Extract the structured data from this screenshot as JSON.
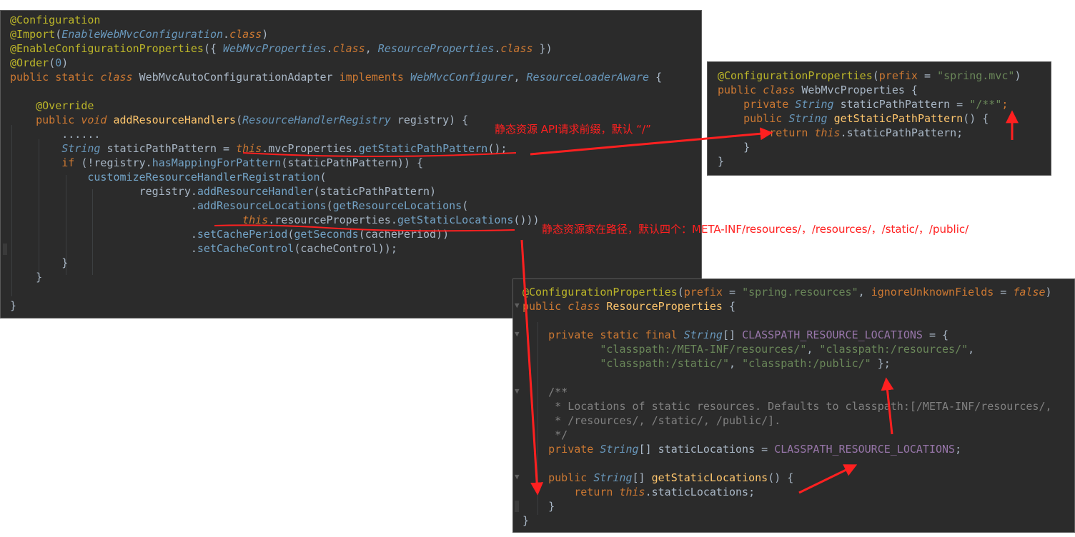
{
  "main_panel": {
    "lines": [
      [
        [
          "ann",
          "@Configuration"
        ]
      ],
      [
        [
          "ann",
          "@Import"
        ],
        [
          "pl",
          "("
        ],
        [
          "ty",
          "EnableWebMvcConfiguration"
        ],
        [
          "pl",
          "."
        ],
        [
          "kw it",
          "class"
        ],
        [
          "pl",
          ")"
        ]
      ],
      [
        [
          "ann",
          "@EnableConfigurationProperties"
        ],
        [
          "pl",
          "({ "
        ],
        [
          "ty",
          "WebMvcProperties"
        ],
        [
          "pl",
          "."
        ],
        [
          "kw it",
          "class"
        ],
        [
          "pl",
          ", "
        ],
        [
          "ty",
          "ResourceProperties"
        ],
        [
          "pl",
          "."
        ],
        [
          "kw it",
          "class"
        ],
        [
          "pl",
          " })"
        ]
      ],
      [
        [
          "ann",
          "@Order"
        ],
        [
          "pl",
          "("
        ],
        [
          "num",
          "0"
        ],
        [
          "pl",
          ")"
        ]
      ],
      [
        [
          "kw",
          "public static "
        ],
        [
          "kw it",
          "class "
        ],
        [
          "pl",
          "WebMvcAutoConfigurationAdapter "
        ],
        [
          "kw",
          "implements "
        ],
        [
          "ty",
          "WebMvcConfigurer"
        ],
        [
          "pl",
          ", "
        ],
        [
          "ty",
          "ResourceLoaderAware"
        ],
        [
          "pl",
          " {"
        ]
      ],
      [],
      [
        [
          "pl",
          "    "
        ],
        [
          "ann",
          "@Override"
        ]
      ],
      [
        [
          "pl",
          "    "
        ],
        [
          "kw",
          "public "
        ],
        [
          "kw it",
          "void "
        ],
        [
          "fn",
          "addResourceHandlers"
        ],
        [
          "pl",
          "("
        ],
        [
          "ty",
          "ResourceHandlerRegistry "
        ],
        [
          "pl",
          "registry) {"
        ]
      ],
      [
        [
          "pl",
          "        ......"
        ]
      ],
      [
        [
          "pl",
          "        "
        ],
        [
          "ty",
          "String "
        ],
        [
          "pl",
          "staticPathPattern = "
        ],
        [
          "kw it",
          "this"
        ],
        [
          "pl",
          ".mvcProperties."
        ],
        [
          "mth",
          "getStaticPathPattern"
        ],
        [
          "pl",
          "();"
        ]
      ],
      [
        [
          "pl",
          "        "
        ],
        [
          "kw",
          "if "
        ],
        [
          "pl",
          "(!registry."
        ],
        [
          "mth",
          "hasMappingForPattern"
        ],
        [
          "pl",
          "(staticPathPattern)) {"
        ]
      ],
      [
        [
          "pl",
          "            "
        ],
        [
          "mth",
          "customizeResourceHandlerRegistration"
        ],
        [
          "pl",
          "("
        ]
      ],
      [
        [
          "pl",
          "                    registry."
        ],
        [
          "mth",
          "addResourceHandler"
        ],
        [
          "pl",
          "(staticPathPattern)"
        ]
      ],
      [
        [
          "pl",
          "                            ."
        ],
        [
          "mth",
          "addResourceLocations"
        ],
        [
          "pl",
          "("
        ],
        [
          "mth",
          "getResourceLocations"
        ],
        [
          "pl",
          "("
        ]
      ],
      [
        [
          "pl",
          "                                    "
        ],
        [
          "kw it",
          "this"
        ],
        [
          "pl",
          ".resourceProperties."
        ],
        [
          "mth",
          "getStaticLocations"
        ],
        [
          "pl",
          "()))"
        ]
      ],
      [
        [
          "pl",
          "                            ."
        ],
        [
          "mth",
          "setCachePeriod"
        ],
        [
          "pl",
          "("
        ],
        [
          "mth",
          "getSeconds"
        ],
        [
          "pl",
          "(cachePeriod))"
        ]
      ],
      [
        [
          "pl",
          "                            ."
        ],
        [
          "mth",
          "setCacheControl"
        ],
        [
          "pl",
          "(cacheControl));"
        ]
      ],
      [
        [
          "pl",
          "        }"
        ]
      ],
      [
        [
          "pl",
          "    }"
        ]
      ],
      [],
      [
        [
          "pl",
          "}"
        ]
      ]
    ]
  },
  "webmvc_panel": {
    "lines": [
      [
        [
          "ann",
          "@ConfigurationProperties"
        ],
        [
          "pl",
          "("
        ],
        [
          "prm",
          "prefix"
        ],
        [
          "pl",
          " = "
        ],
        [
          "str",
          "\"spring.mvc\""
        ],
        [
          "pl",
          ")"
        ]
      ],
      [
        [
          "kw",
          "public "
        ],
        [
          "kw it",
          "class "
        ],
        [
          "pl",
          "WebMvcProperties {"
        ]
      ],
      [
        [
          "pl",
          "    "
        ],
        [
          "kw",
          "private "
        ],
        [
          "ty",
          "String "
        ],
        [
          "pl",
          "staticPathPattern = "
        ],
        [
          "str",
          "\"/**\""
        ],
        [
          "kw",
          ";"
        ]
      ],
      [
        [
          "pl",
          "    "
        ],
        [
          "kw",
          "public "
        ],
        [
          "ty",
          "String "
        ],
        [
          "fn",
          "getStaticPathPattern"
        ],
        [
          "pl",
          "() {"
        ]
      ],
      [
        [
          "pl",
          "        "
        ],
        [
          "kw",
          "return "
        ],
        [
          "kw it",
          "this"
        ],
        [
          "pl",
          ".staticPathPattern;"
        ]
      ],
      [
        [
          "pl",
          "    }"
        ]
      ],
      [
        [
          "pl",
          "}"
        ]
      ]
    ]
  },
  "resource_panel": {
    "lines": [
      [
        [
          "ann",
          "@ConfigurationProperties"
        ],
        [
          "pl",
          "("
        ],
        [
          "prm",
          "prefix"
        ],
        [
          "pl",
          " = "
        ],
        [
          "str",
          "\"spring.resources\""
        ],
        [
          "pl",
          ", "
        ],
        [
          "prm",
          "ignoreUnknownFields"
        ],
        [
          "pl",
          " = "
        ],
        [
          "kw it",
          "false"
        ],
        [
          "pl",
          ")"
        ]
      ],
      [
        [
          "kw",
          "public "
        ],
        [
          "kw it",
          "class "
        ],
        [
          "fn",
          "ResourceProperties"
        ],
        [
          "pl",
          " {"
        ]
      ],
      [],
      [
        [
          "pl",
          "    "
        ],
        [
          "kw",
          "private static final "
        ],
        [
          "ty",
          "String"
        ],
        [
          "pl",
          "[] "
        ],
        [
          "const",
          "CLASSPATH_RESOURCE_LOCATIONS"
        ],
        [
          "pl",
          " = {"
        ]
      ],
      [
        [
          "pl",
          "            "
        ],
        [
          "str",
          "\"classpath:/META-INF/resources/\""
        ],
        [
          "pl",
          ", "
        ],
        [
          "str",
          "\"classpath:/resources/\""
        ],
        [
          "pl",
          ","
        ]
      ],
      [
        [
          "pl",
          "            "
        ],
        [
          "str",
          "\"classpath:/static/\""
        ],
        [
          "pl",
          ", "
        ],
        [
          "str",
          "\"classpath:/public/\""
        ],
        [
          "pl",
          " };"
        ]
      ],
      [],
      [
        [
          "pl",
          "    "
        ],
        [
          "cm",
          "/**"
        ]
      ],
      [
        [
          "cm",
          "     * Locations of static resources. Defaults to classpath:[/META-INF/resources/,"
        ]
      ],
      [
        [
          "cm",
          "     * /resources/, /static/, /public/]."
        ]
      ],
      [
        [
          "cm",
          "     */"
        ]
      ],
      [
        [
          "pl",
          "    "
        ],
        [
          "kw",
          "private "
        ],
        [
          "ty",
          "String"
        ],
        [
          "pl",
          "[] staticLocations = "
        ],
        [
          "const",
          "CLASSPATH_RESOURCE_LOCATIONS"
        ],
        [
          "pl",
          ";"
        ]
      ],
      [],
      [
        [
          "pl",
          "    "
        ],
        [
          "kw",
          "public "
        ],
        [
          "ty",
          "String"
        ],
        [
          "pl",
          "[] "
        ],
        [
          "fn",
          "getStaticLocations"
        ],
        [
          "pl",
          "() {"
        ]
      ],
      [
        [
          "pl",
          "        "
        ],
        [
          "kw",
          "return "
        ],
        [
          "kw it",
          "this"
        ],
        [
          "pl",
          ".staticLocations;"
        ]
      ],
      [
        [
          "pl",
          "    }"
        ]
      ],
      [
        [
          "pl",
          "}"
        ]
      ]
    ]
  },
  "annotations": {
    "note1": "静态资源 API请求前缀，默认 “/”",
    "note2": "静态资源家在路径，默认四个：META-INF/resources/，/resources/，/static/，/public/"
  },
  "colors": {
    "editor_bg": "#2b2b2b",
    "annotation_red": "#ff2020"
  }
}
